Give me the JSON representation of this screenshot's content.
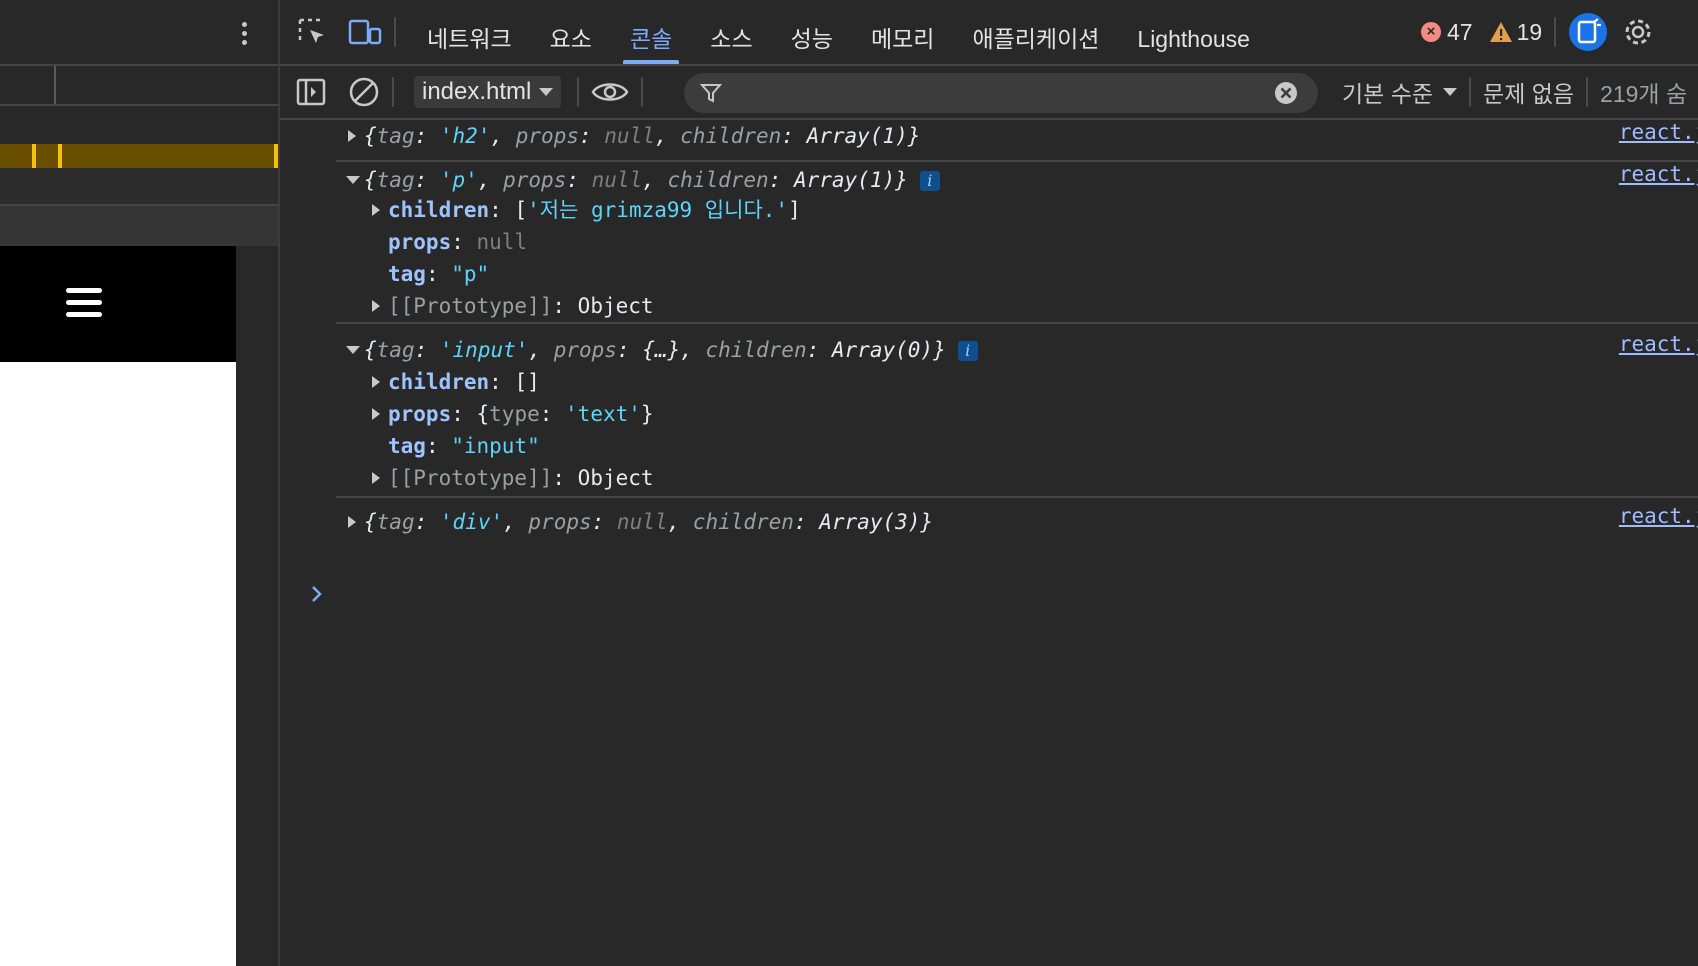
{
  "devtools": {
    "tabs": [
      "네트워크",
      "요소",
      "콘솔",
      "소스",
      "성능",
      "메모리",
      "애플리케이션",
      "Lighthouse"
    ],
    "active_tab": "콘솔",
    "error_count": "47",
    "warning_count": "19"
  },
  "toolbar": {
    "context": "index.html",
    "log_level": "기본 수준",
    "issues": "문제 없음",
    "hidden_count": "219개 숨"
  },
  "console": {
    "source": "react.js",
    "entries": [
      {
        "preview": {
          "tag": "'h2'",
          "props": "null",
          "children": "Array(1)"
        }
      },
      {
        "preview": {
          "tag": "'p'",
          "props": "null",
          "children": "Array(1)"
        },
        "children_val": "'저는 grimza99 입니다.'",
        "props_val": "null",
        "tag_val": "\"p\"",
        "proto_key": "[[Prototype]]",
        "proto_val": "Object"
      },
      {
        "preview": {
          "tag": "'input'",
          "props": "{…}",
          "children": "Array(0)"
        },
        "children_val": "[]",
        "props_type": "'text'",
        "tag_val": "\"input\"",
        "proto_key": "[[Prototype]]",
        "proto_val": "Object"
      },
      {
        "preview": {
          "tag": "'div'",
          "props": "null",
          "children": "Array(3)"
        }
      }
    ]
  },
  "colors": {
    "accent": "#7cacf8",
    "error": "#f28b82",
    "warning": "#e2a04e",
    "string": "#5cd5fb"
  }
}
